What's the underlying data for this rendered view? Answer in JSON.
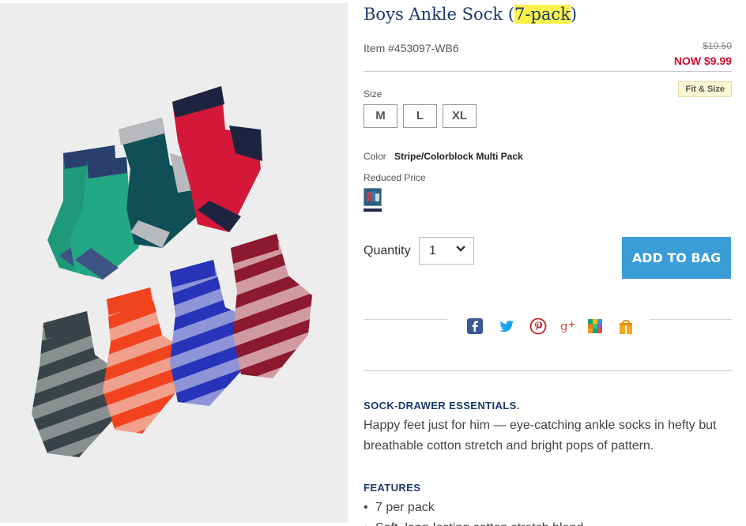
{
  "product": {
    "title_main": "Boys Ankle Sock (",
    "title_highlight": "7-pack",
    "title_end": ")",
    "item_number": "Item #453097-WB6",
    "old_price": "$19.50",
    "now_price": "NOW $9.99",
    "fit_size_label": "Fit & Size"
  },
  "size": {
    "label": "Size",
    "options": [
      "M",
      "L",
      "XL"
    ]
  },
  "color": {
    "label": "Color",
    "value": "Stripe/Colorblock Multi Pack",
    "reduced_label": "Reduced Price"
  },
  "quantity": {
    "label": "Quantity",
    "value": "1"
  },
  "cart": {
    "add_label": "ADD TO BAG"
  },
  "share_icons": [
    "facebook-icon",
    "twitter-icon",
    "pinterest-icon",
    "google-plus-icon",
    "colorful-grid-icon",
    "gift-bag-icon"
  ],
  "description": {
    "heading": "SOCK-DRAWER ESSENTIALS.",
    "body": "Happy feet just for him — eye-catching ankle socks in hefty but breathable cotton stretch and bright pops of pattern."
  },
  "features": {
    "heading": "FEATURES",
    "items": [
      "7 per pack",
      "Soft, long-lasting cotton stretch blend"
    ]
  },
  "colors": {
    "title": "#1a3a6a",
    "accent_button": "#3a9dd6",
    "sale_red": "#c9102e",
    "highlight": "#fbf34a"
  }
}
